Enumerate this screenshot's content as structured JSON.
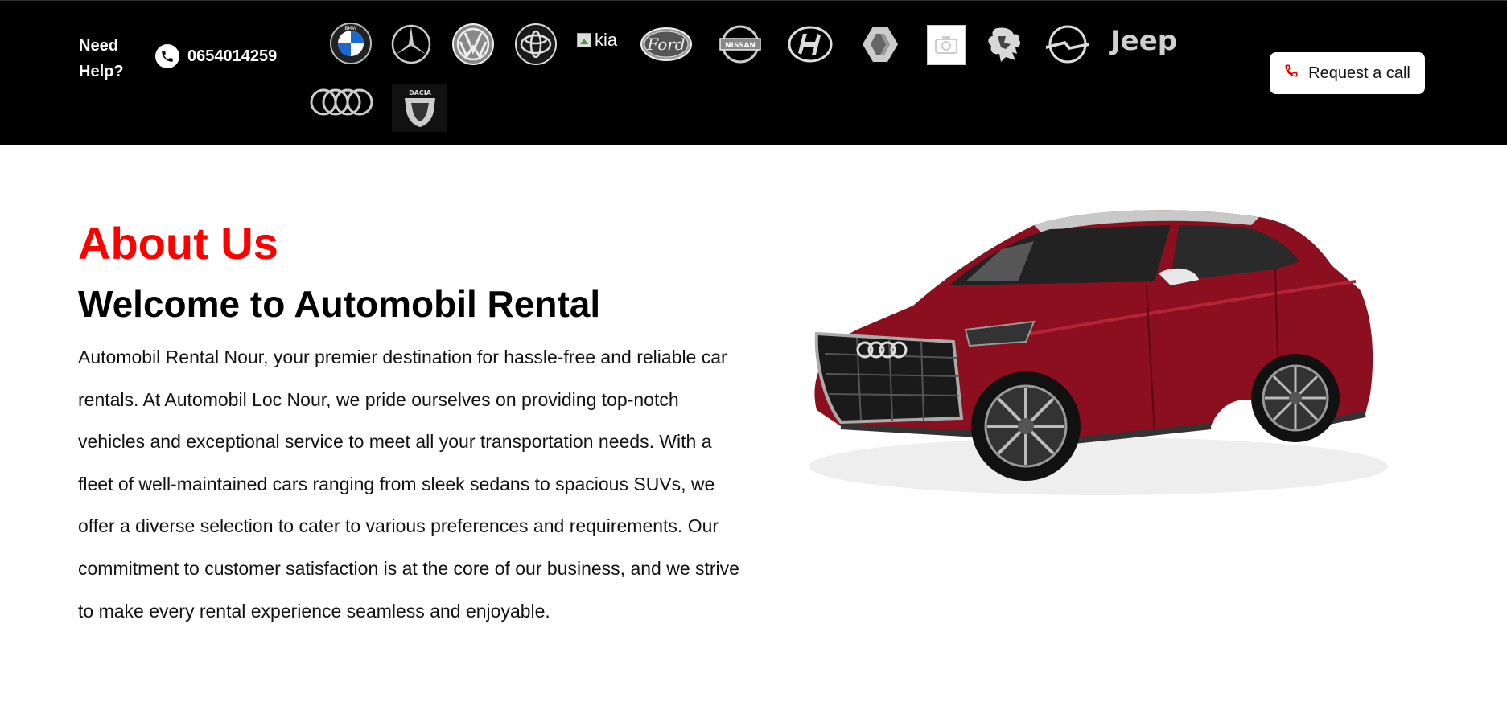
{
  "header": {
    "need_help": "Need Help?",
    "phone": "0654014259",
    "request_call": "Request a call",
    "broken_logo_alt": "kia",
    "brands": [
      {
        "name": "BMW",
        "icon": "bmw-logo-icon"
      },
      {
        "name": "Mercedes",
        "icon": "mercedes-logo-icon"
      },
      {
        "name": "Volkswagen",
        "icon": "volkswagen-logo-icon"
      },
      {
        "name": "Toyota",
        "icon": "toyota-logo-icon"
      },
      {
        "name": "Kia",
        "icon": "broken-image-icon"
      },
      {
        "name": "Ford",
        "icon": "ford-logo-icon"
      },
      {
        "name": "Nissan",
        "icon": "nissan-logo-icon"
      },
      {
        "name": "Hyundai",
        "icon": "hyundai-logo-icon"
      },
      {
        "name": "Renault",
        "icon": "renault-logo-icon"
      },
      {
        "name": "Placeholder",
        "icon": "placeholder-image-icon"
      },
      {
        "name": "Peugeot",
        "icon": "peugeot-logo-icon"
      },
      {
        "name": "Opel",
        "icon": "opel-logo-icon"
      },
      {
        "name": "Jeep",
        "icon": "jeep-logo-icon"
      },
      {
        "name": "Audi",
        "icon": "audi-logo-icon"
      },
      {
        "name": "Dacia",
        "icon": "dacia-logo-icon"
      }
    ],
    "logo_text": {
      "bmw": "BMW",
      "ford": "Ford",
      "nissan": "NISSAN",
      "jeep": "Jeep",
      "dacia": "DACIA"
    }
  },
  "about": {
    "title": "About Us",
    "heading": "Welcome to Automobil Rental",
    "body": "Automobil Rental Nour, your premier destination for hassle-free and reliable car rentals. At Automobil Loc Nour, we pride ourselves on providing top-notch vehicles and exceptional service to meet all your transportation needs. With a fleet of well-maintained cars ranging from sleek sedans to spacious SUVs, we offer a diverse selection to cater to various preferences and requirements. Our commitment to customer satisfaction is at the core of our business, and we strive to make every rental experience seamless and enjoyable.",
    "image": "red-audi-suv-image"
  },
  "colors": {
    "accent": "#ff0000",
    "topbar_bg": "#000000",
    "car_body": "#8b0f1e"
  }
}
